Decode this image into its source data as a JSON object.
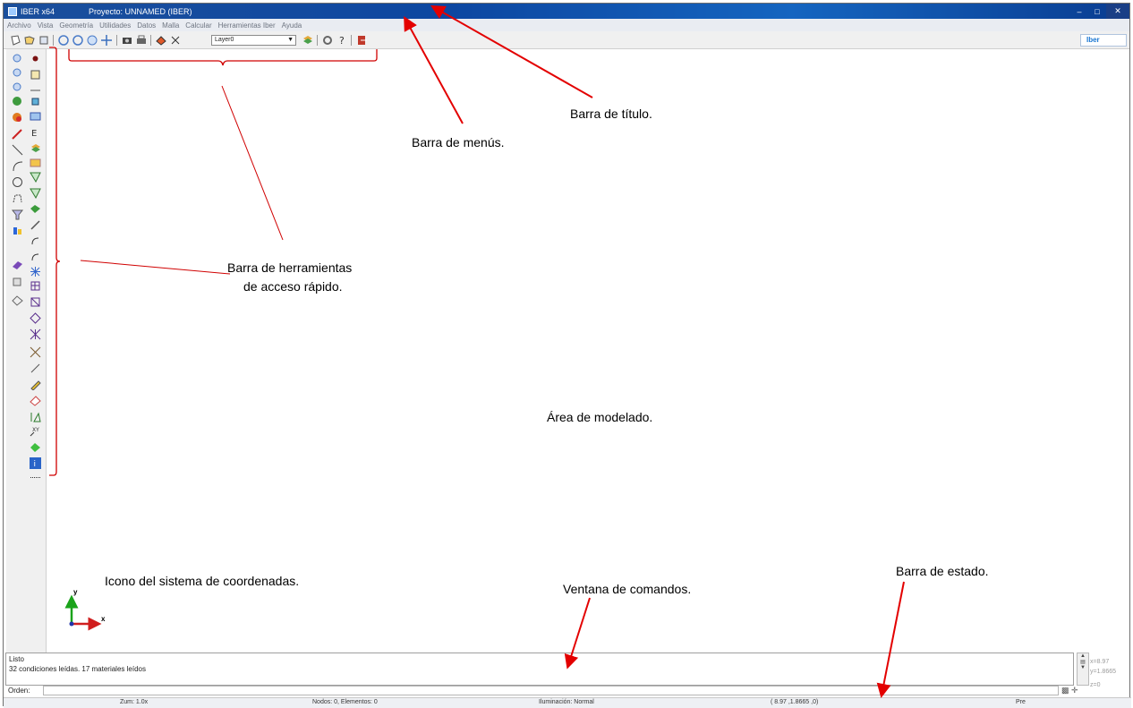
{
  "window": {
    "app_title": "IBER x64",
    "project_title": "Proyecto: UNNAMED (IBER)",
    "brand_text": "Iber"
  },
  "menu": [
    "Archivo",
    "Vista",
    "Geometría",
    "Utilidades",
    "Datos",
    "Malla",
    "Calcular",
    "Herramientas Iber",
    "Ayuda"
  ],
  "toolbar": {
    "layer_value": "Layer0"
  },
  "command_window": {
    "line1": "Listo",
    "line2": "32 condiciones leídas. 17 materiales leídos",
    "orden_label": "Orden:"
  },
  "coordinates": {
    "x": "x=8.97",
    "y": "y=1.8665",
    "z": "z=0"
  },
  "status_bar": {
    "zoom": "Zum: 1.0x",
    "nodes": "Nodos: 0, Elementos: 0",
    "lighting": "Iluminación: Normal",
    "position": "( 8.97 ,1.8665 ,0)",
    "mode": "Pre"
  },
  "axis_labels": {
    "y": "y",
    "x": "x"
  },
  "annotations": {
    "title_bar": "Barra de título.",
    "menu_bar": "Barra de menús.",
    "quick_access_1": "Barra de herramientas",
    "quick_access_2": "de acceso rápido.",
    "modeling_area": "Área de modelado.",
    "coord_icon": "Icono del sistema de coordenadas.",
    "command_window": "Ventana de comandos.",
    "status_bar": "Barra de estado."
  },
  "colors": {
    "titlebar": "#0d47a1",
    "annotation_arrow": "#e30000",
    "annotation_bracket": "#d00000",
    "axis_y": "#1aa31a",
    "axis_x": "#d01e1e"
  }
}
